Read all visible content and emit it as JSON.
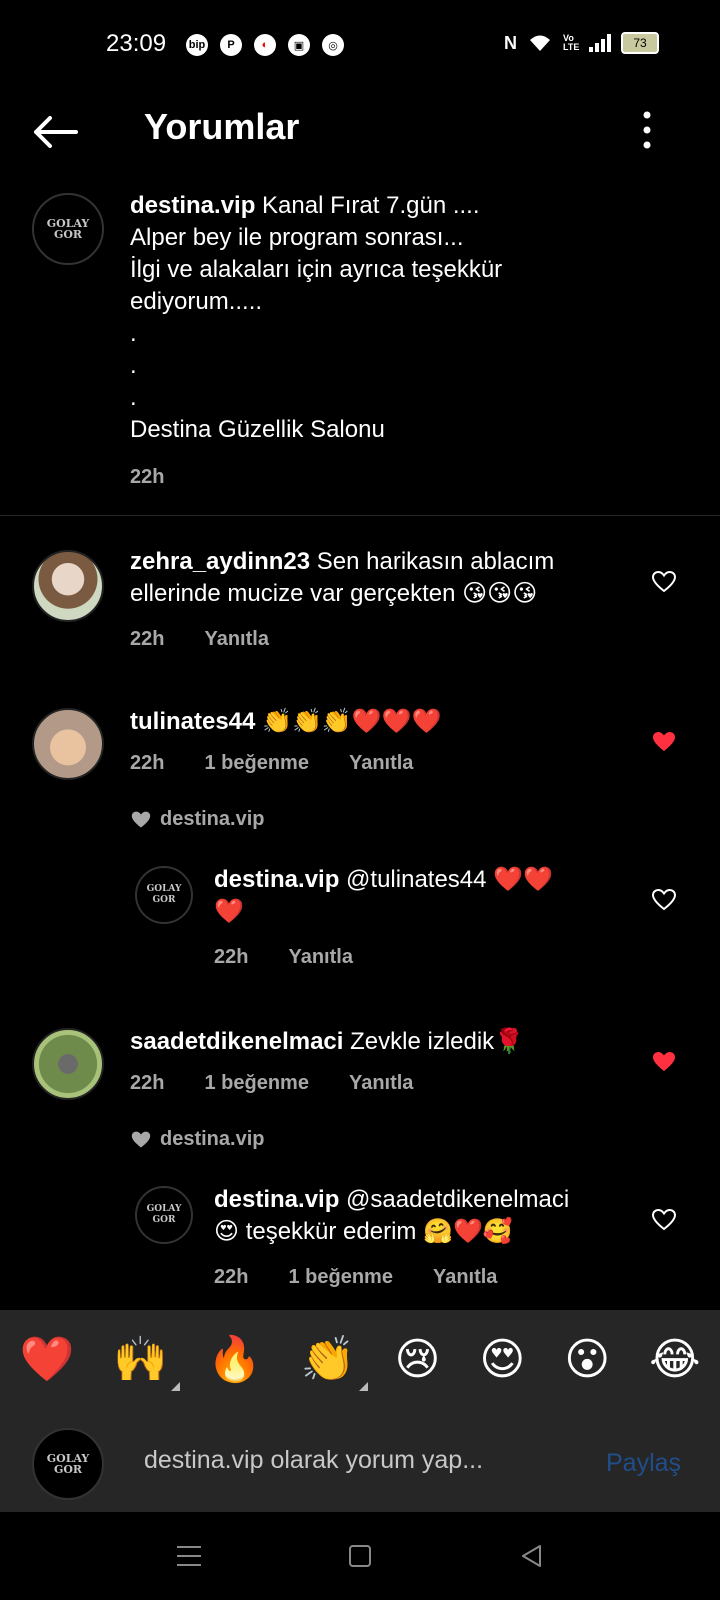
{
  "status_bar": {
    "time": "23:09",
    "battery": "73",
    "volte": "Vo LTE"
  },
  "header": {
    "title": "Yorumlar"
  },
  "caption": {
    "username": "destina.vip",
    "lines": [
      "Kanal Fırat 7.gün ....",
      "Alper bey ile program sonrası...",
      "İlgi ve alakaları için ayrıca teşekkür",
      "ediyorum.....",
      ".",
      ".",
      ".",
      "Destina Güzellik Salonu"
    ],
    "time": "22h",
    "avatar_text": "GOLAY GOR"
  },
  "comments": [
    {
      "username": "zehra_aydinn23",
      "text_line1": "Sen harikasın ablacım",
      "text_line2": "ellerinde mucize var gerçekten 😘😘😘",
      "time": "22h",
      "reply_label": "Yanıtla"
    },
    {
      "username": "tulinates44",
      "text": "👏👏👏❤️❤️❤️",
      "time": "22h",
      "likes": "1 beğenme",
      "reply_label": "Yanıtla",
      "liked_by": "destina.vip",
      "reply": {
        "username": "destina.vip",
        "text_line1": "@tulinates44 ❤️❤️",
        "text_line2": "❤️",
        "time": "22h",
        "reply_label": "Yanıtla"
      }
    },
    {
      "username": "saadetdikenelmaci",
      "text": "Zevkle izledik🌹",
      "time": "22h",
      "likes": "1 beğenme",
      "reply_label": "Yanıtla",
      "liked_by": "destina.vip",
      "reply": {
        "username": "destina.vip",
        "text_line1": "@saadetdikenelmaci",
        "text_line2": "😍 teşekkür ederim 🤗❤️🥰",
        "time": "22h",
        "likes": "1 beğenme",
        "reply_label": "Yanıtla"
      }
    }
  ],
  "emoji_bar": [
    "❤️",
    "🙌",
    "🔥",
    "👏",
    "😢",
    "😍",
    "😮",
    "😂"
  ],
  "input": {
    "placeholder": "destina.vip olarak yorum yap...",
    "share_label": "Paylaş"
  },
  "colors": {
    "background": "#000000",
    "secondary_text": "#a8a8a8",
    "like_red": "#ff3040",
    "share_blue": "#1f4e8a"
  }
}
